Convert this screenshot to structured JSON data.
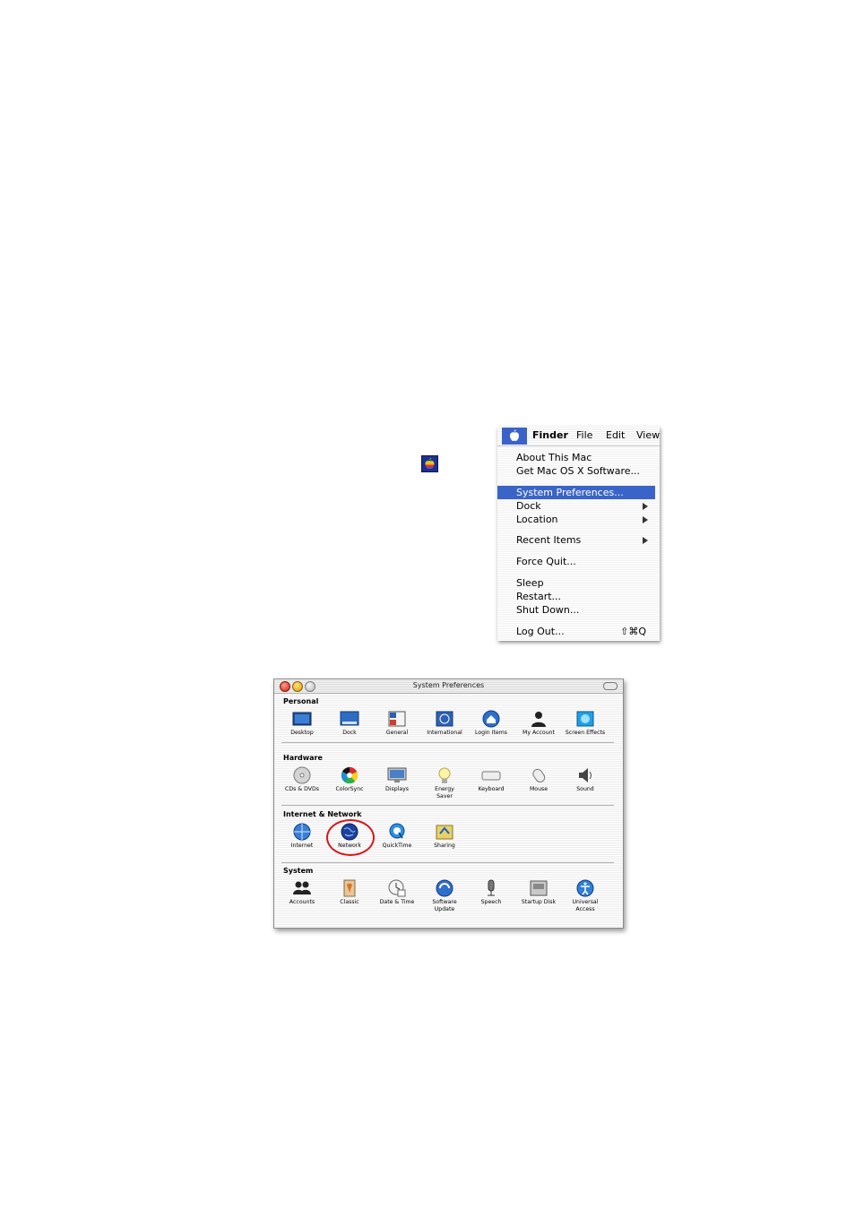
{
  "menu": {
    "menubar": [
      "Finder",
      "File",
      "Edit",
      "View"
    ],
    "items": [
      {
        "label": "About This Mac",
        "submenu": false,
        "shortcut": "",
        "selected": false
      },
      {
        "label": "Get Mac OS X Software...",
        "submenu": false,
        "shortcut": "",
        "selected": false
      },
      {
        "label": "System Preferences...",
        "submenu": false,
        "shortcut": "",
        "selected": true
      },
      {
        "label": "Dock",
        "submenu": true,
        "shortcut": "",
        "selected": false
      },
      {
        "label": "Location",
        "submenu": true,
        "shortcut": "",
        "selected": false
      },
      {
        "label": "Recent Items",
        "submenu": true,
        "shortcut": "",
        "selected": false
      },
      {
        "label": "Force Quit...",
        "submenu": false,
        "shortcut": "",
        "selected": false
      },
      {
        "label": "Sleep",
        "submenu": false,
        "shortcut": "",
        "selected": false
      },
      {
        "label": "Restart...",
        "submenu": false,
        "shortcut": "",
        "selected": false
      },
      {
        "label": "Shut Down...",
        "submenu": false,
        "shortcut": "",
        "selected": false
      },
      {
        "label": "Log Out...",
        "submenu": false,
        "shortcut": "⇧⌘Q",
        "selected": false
      }
    ]
  },
  "window": {
    "title": "System Preferences",
    "sections": [
      {
        "title": "Personal",
        "panes": [
          "Desktop",
          "Dock",
          "General",
          "International",
          "Login Items",
          "My Account",
          "Screen Effects"
        ]
      },
      {
        "title": "Hardware",
        "panes": [
          "CDs & DVDs",
          "ColorSync",
          "Displays",
          "Energy\nSaver",
          "Keyboard",
          "Mouse",
          "Sound"
        ]
      },
      {
        "title": "Internet & Network",
        "panes": [
          "Internet",
          "Network",
          "QuickTime",
          "Sharing"
        ]
      },
      {
        "title": "System",
        "panes": [
          "Accounts",
          "Classic",
          "Date & Time",
          "Software\nUpdate",
          "Speech",
          "Startup Disk",
          "Universal\nAccess"
        ]
      }
    ],
    "highlighted_pane": "Network"
  },
  "colors": {
    "menu_highlight": "#3a64c8",
    "annotation_circle": "#d8161c"
  }
}
